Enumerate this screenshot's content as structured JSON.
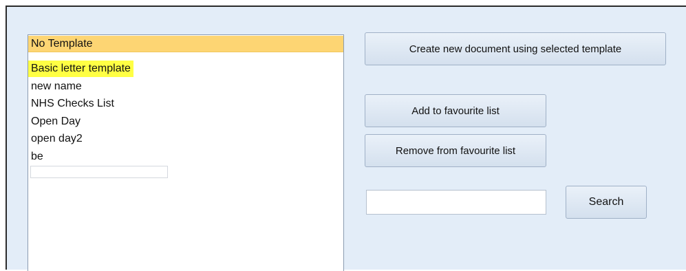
{
  "template_list": {
    "items": [
      {
        "label": "No Template",
        "state": "selected"
      },
      {
        "label": "Basic letter template",
        "state": "highlighted"
      },
      {
        "label": "new name",
        "state": "normal"
      },
      {
        "label": "NHS Checks List",
        "state": "normal"
      },
      {
        "label": "Open Day",
        "state": "normal"
      },
      {
        "label": "open day2",
        "state": "normal"
      },
      {
        "label": "be",
        "state": "normal"
      }
    ],
    "new_item_value": ""
  },
  "actions": {
    "create_label": "Create new document using selected template",
    "add_favourite_label": "Add to favourite list",
    "remove_favourite_label": "Remove from favourite list"
  },
  "search": {
    "value": "",
    "placeholder": "",
    "button_label": "Search"
  },
  "colors": {
    "panel_background": "#e3edf8",
    "selected_row": "#fdd573",
    "highlighted_row": "#ffff44"
  }
}
